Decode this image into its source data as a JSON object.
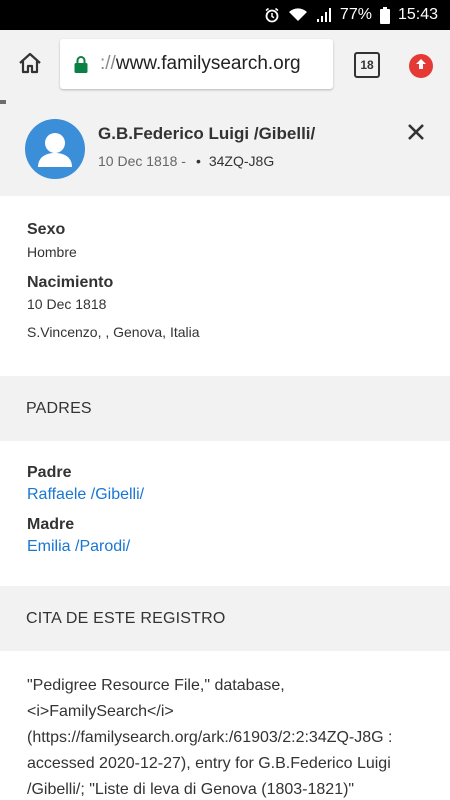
{
  "status_bar": {
    "battery_percent": "77%",
    "time": "15:43"
  },
  "browser": {
    "url_scheme": "://",
    "url_host": "www.familysearch.org",
    "tab_count": "18"
  },
  "person": {
    "name": "G.B.Federico Luigi /Gibelli/",
    "lifespan": "10 Dec 1818 -",
    "separator": "•",
    "id": "34ZQ-J8G"
  },
  "vitals": {
    "sex_label": "Sexo",
    "sex_value": "Hombre",
    "birth_label": "Nacimiento",
    "birth_date": "10 Dec 1818",
    "birth_place": "S.Vincenzo, , Genova, Italia"
  },
  "parents": {
    "section_title": "PADRES",
    "father_label": "Padre",
    "father_name": "Raffaele /Gibelli/",
    "mother_label": "Madre",
    "mother_name": "Emilia /Parodi/"
  },
  "citation": {
    "section_title": "CITA DE ESTE REGISTRO",
    "text": "\"Pedigree Resource File,\" database, <i>FamilySearch</i> (https://familysearch.org/ark:/61903/2:2:34ZQ-J8G : accessed 2020-12-27), entry for G.B.Federico Luigi /Gibelli/; \"Liste di leva di Genova (1803-1821)\""
  },
  "colors": {
    "link": "#1976d2",
    "avatar": "#3b8ed8",
    "update_badge": "#e53935",
    "secure_lock": "#0b8043"
  }
}
